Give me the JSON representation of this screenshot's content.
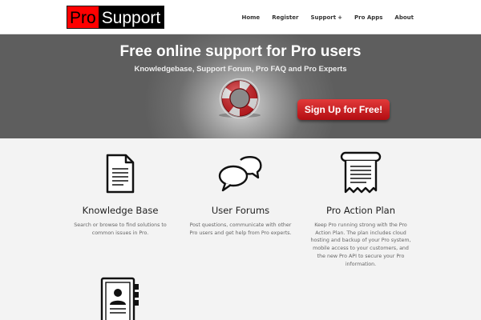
{
  "logo": {
    "part1": "Pro",
    "part2": "Support"
  },
  "nav": [
    {
      "label": "Home"
    },
    {
      "label": "Register"
    },
    {
      "label": "Support",
      "suffix": "+"
    },
    {
      "label": "Pro Apps"
    },
    {
      "label": "About"
    }
  ],
  "hero": {
    "title": "Free online support for Pro users",
    "subtitle": "Knowledgebase, Support Forum, Pro FAQ and Pro Experts",
    "cta_label": "Sign Up for Free!",
    "icon": "lifebuoy-icon"
  },
  "features": [
    {
      "icon": "document-icon",
      "title": "Knowledge Base",
      "desc": "Search or browse to find solutions to common issues in Pro."
    },
    {
      "icon": "chat-bubbles-icon",
      "title": "User Forums",
      "desc": "Post questions, communicate with other Pro users and get help from Pro experts."
    },
    {
      "icon": "scroll-icon",
      "title": "Pro Action Plan",
      "desc": "Keep Pro running strong with the Pro Action Plan. The plan includes cloud hosting and backup of your Pro system, mobile access to your customers, and the new Pro API to secure your Pro information."
    },
    {
      "icon": "contact-book-icon"
    }
  ],
  "colors": {
    "logo_red": "#ff0000",
    "cta_red": "#c8161d",
    "hero_gray": "#6f6f6f"
  }
}
